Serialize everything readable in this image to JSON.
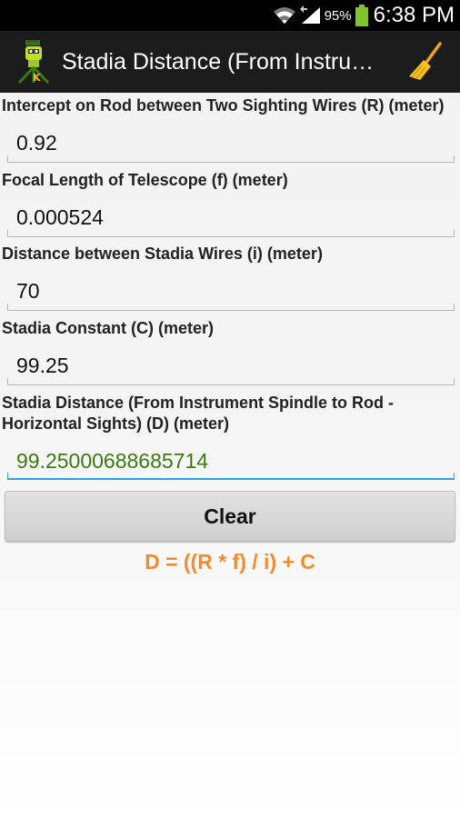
{
  "status_bar": {
    "battery_percent": "95%",
    "time": "6:38 PM",
    "icons": [
      "wifi-icon",
      "signal-icon",
      "battery-icon"
    ]
  },
  "action_bar": {
    "title": "Stadia Distance (From Instrument Spindle to Rod - Horizontal Sights)",
    "logo_icon": "surveyor-logo-icon",
    "clear_icon": "broom-icon"
  },
  "fields": [
    {
      "label": "Intercept on Rod between Two Sighting Wires (R) (meter)",
      "value": "0.92"
    },
    {
      "label": "Focal Length of Telescope (f) (meter)",
      "value": "0.000524"
    },
    {
      "label": "Distance between Stadia Wires (i) (meter)",
      "value": "70"
    },
    {
      "label": "Stadia Constant (C) (meter)",
      "value": "99.25"
    }
  ],
  "result": {
    "label": "Stadia Distance (From Instrument Spindle to Rod - Horizontal Sights) (D) (meter)",
    "value": "99.25000688685714"
  },
  "clear_button_label": "Clear",
  "formula": "D = ((R * f) / i) + C",
  "colors": {
    "accent_underline": "#33a3cf",
    "result_text": "#3a7a12",
    "formula_text": "#f28a2e"
  }
}
